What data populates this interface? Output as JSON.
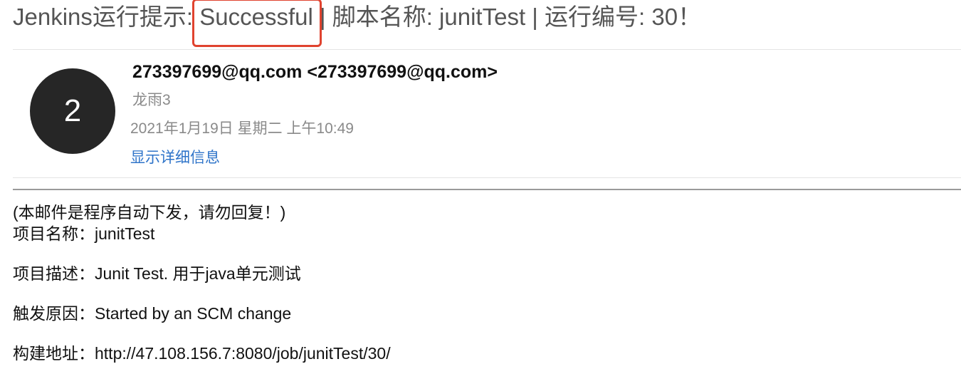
{
  "subject": {
    "prefix": "Jenkins运行提示: ",
    "status": "Successful",
    "suffix": " | 脚本名称: junitTest | 运行编号:   30！"
  },
  "header": {
    "avatar_letter": "2",
    "sender": "273397699@qq.com <273397699@qq.com>",
    "recipient": "龙雨3",
    "date": "2021年1月19日 星期二 上午10:49",
    "details_link": "显示详细信息"
  },
  "body": {
    "note": "(本邮件是程序自动下发，请勿回复！)",
    "lines": [
      "项目名称：junitTest",
      "项目描述：Junit Test. 用于java单元测试",
      "触发原因：Started by an SCM change",
      "构建地址：http://47.108.156.7:8080/job/junitTest/30/"
    ]
  },
  "colors": {
    "highlight_box": "#e0432f",
    "link": "#2f74c9",
    "avatar_bg": "#262626"
  }
}
